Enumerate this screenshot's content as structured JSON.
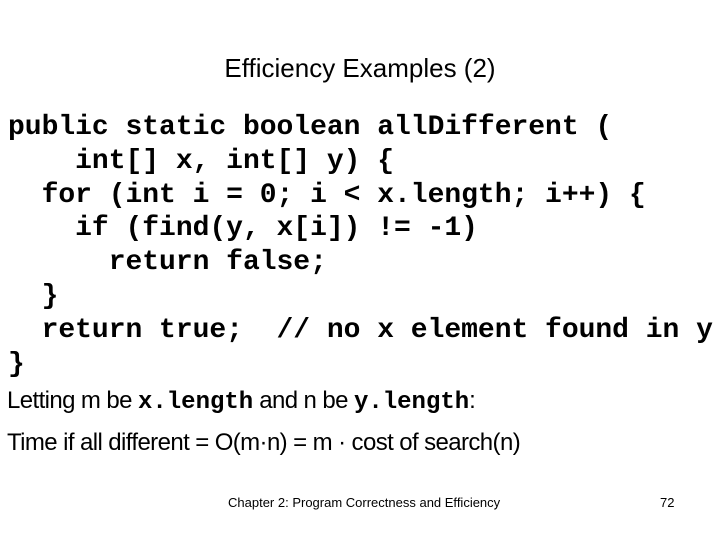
{
  "slide": {
    "title": "Efficiency Examples (2)",
    "code_lines": [
      "public static boolean allDifferent (",
      "    int[] x, int[] y) {",
      "  for (int i = 0; i < x.length; i++) {",
      "    if (find(y, x[i]) != -1)",
      "      return false;",
      "  }",
      "  return true;  // no x element found in y",
      "}"
    ],
    "explanation": {
      "line1": {
        "part1": "Letting m be ",
        "code1": "x.length",
        "part2": " and n be ",
        "code2": "y.length",
        "part3": ":"
      },
      "line2": "Time if all different = O(m·n) = m · cost of search(n)"
    },
    "footer": {
      "chapter": "Chapter 2: Program Correctness and Efficiency",
      "page_number": "72"
    }
  }
}
